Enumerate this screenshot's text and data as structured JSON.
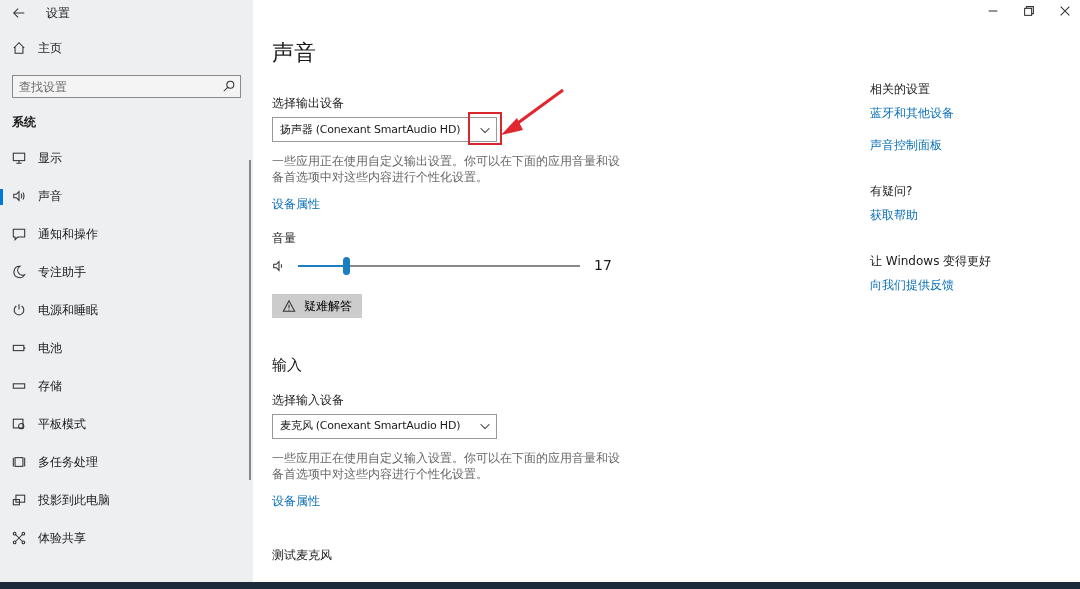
{
  "window": {
    "title": "设置"
  },
  "sidebar": {
    "home": "主页",
    "search": {
      "placeholder": "查找设置"
    },
    "section": "系统",
    "items": [
      {
        "label": "显示",
        "selected": false
      },
      {
        "label": "声音",
        "selected": true
      },
      {
        "label": "通知和操作",
        "selected": false
      },
      {
        "label": "专注助手",
        "selected": false
      },
      {
        "label": "电源和睡眠",
        "selected": false
      },
      {
        "label": "电池",
        "selected": false
      },
      {
        "label": "存储",
        "selected": false
      },
      {
        "label": "平板模式",
        "selected": false
      },
      {
        "label": "多任务处理",
        "selected": false
      },
      {
        "label": "投影到此电脑",
        "selected": false
      },
      {
        "label": "体验共享",
        "selected": false
      }
    ]
  },
  "page": {
    "title": "声音",
    "output": {
      "label": "选择输出设备",
      "device": "扬声器 (Conexant SmartAudio HD)",
      "description": "一些应用正在使用自定义输出设置。你可以在下面的应用音量和设备首选项中对这些内容进行个性化设置。",
      "link": "设备属性"
    },
    "volume": {
      "label": "音量",
      "level": 0.17,
      "reading": "17"
    },
    "troubleshoot": "疑难解答",
    "input": {
      "heading": "输入",
      "label": "选择输入设备",
      "device": "麦克风 (Conexant SmartAudio HD)",
      "description": "一些应用正在使用自定义输入设置。你可以在下面的应用音量和设备首选项中对这些内容进行个性化设置。",
      "link": "设备属性"
    },
    "test_mic": "测试麦克风"
  },
  "related": [
    {
      "heading": "相关的设置",
      "links": [
        "蓝牙和其他设备",
        "声音控制面板"
      ]
    },
    {
      "heading": "有疑问?",
      "links": [
        "获取帮助"
      ]
    },
    {
      "heading": "让 Windows 变得更好",
      "links": [
        "向我们提供反馈"
      ]
    }
  ]
}
